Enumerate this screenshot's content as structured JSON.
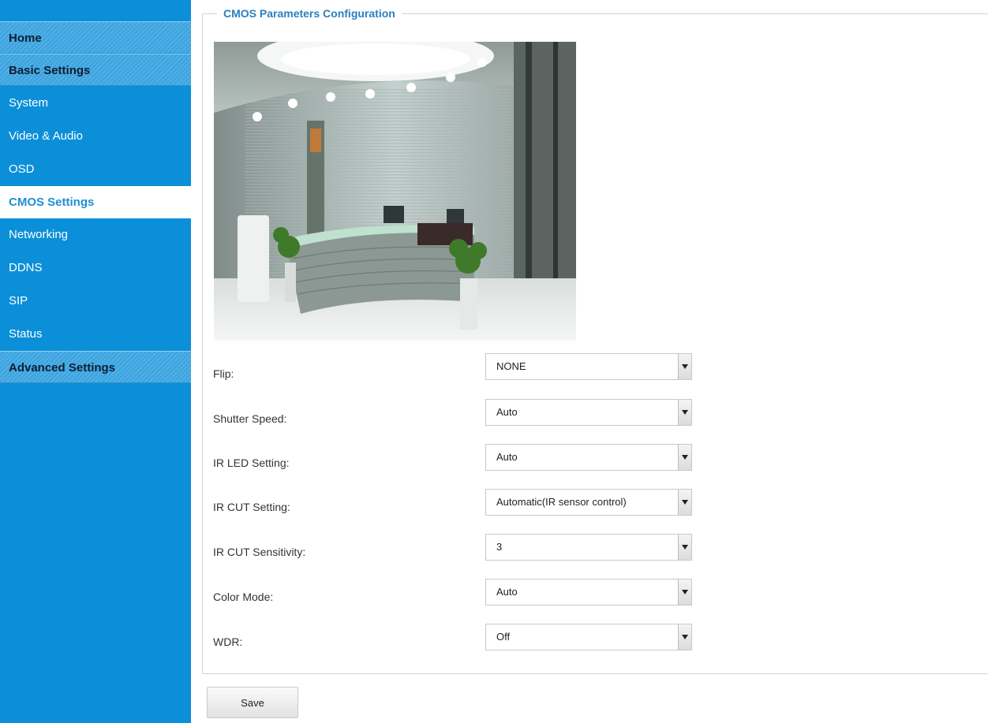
{
  "sidebar": {
    "items": [
      {
        "label": "Home"
      },
      {
        "label": "Basic Settings"
      },
      {
        "label": "System"
      },
      {
        "label": "Video & Audio"
      },
      {
        "label": "OSD"
      },
      {
        "label": "CMOS Settings"
      },
      {
        "label": "Networking"
      },
      {
        "label": "DDNS"
      },
      {
        "label": "SIP"
      },
      {
        "label": "Status"
      },
      {
        "label": "Advanced Settings"
      }
    ]
  },
  "main": {
    "legend": "CMOS Parameters Configuration",
    "fields": [
      {
        "label": "Flip:",
        "value": "NONE"
      },
      {
        "label": "Shutter Speed:",
        "value": "Auto"
      },
      {
        "label": "IR LED Setting:",
        "value": "Auto"
      },
      {
        "label": "IR CUT Setting:",
        "value": "Automatic(IR sensor control)"
      },
      {
        "label": "IR CUT Sensitivity:",
        "value": "3"
      },
      {
        "label": "Color Mode:",
        "value": "Auto"
      },
      {
        "label": "WDR:",
        "value": "Off"
      }
    ],
    "save_label": "Save"
  },
  "colors": {
    "sidebar_bg": "#0b8fd8",
    "active_text": "#1f8fd6",
    "legend_text": "#2a7fbf"
  }
}
